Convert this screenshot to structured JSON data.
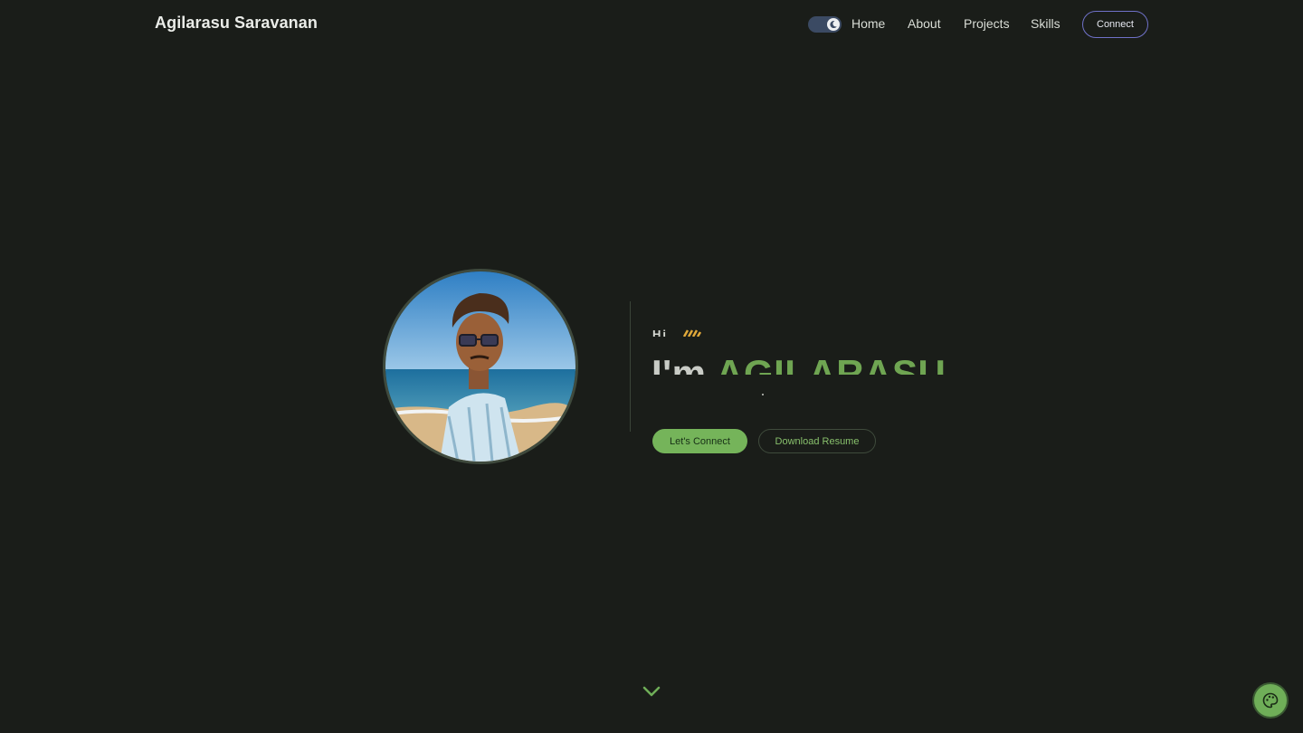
{
  "header": {
    "brand": "Agilarasu Saravanan",
    "nav": [
      {
        "label": "Home"
      },
      {
        "label": "About"
      },
      {
        "label": "Projects"
      },
      {
        "label": "Skills"
      }
    ],
    "connect_label": "Connect",
    "theme_toggle_state": "dark"
  },
  "hero": {
    "greeting": "Hi",
    "im": "I'm",
    "name": "AGILARASU",
    "primary_button": "Let's Connect",
    "secondary_button": "Download Resume",
    "avatar_alt": "Illustrated portrait at a beach"
  },
  "icons": {
    "toggle": "moon-icon",
    "wave": "wave-icon",
    "scroll": "chevron-down-icon",
    "palette": "palette-icon"
  },
  "colors": {
    "background": "#1a1d19",
    "accent": "#6fa552",
    "connect_border": "#6f71c8",
    "primary_button": "#75b45a",
    "toggle_track": "#3b4a63"
  }
}
